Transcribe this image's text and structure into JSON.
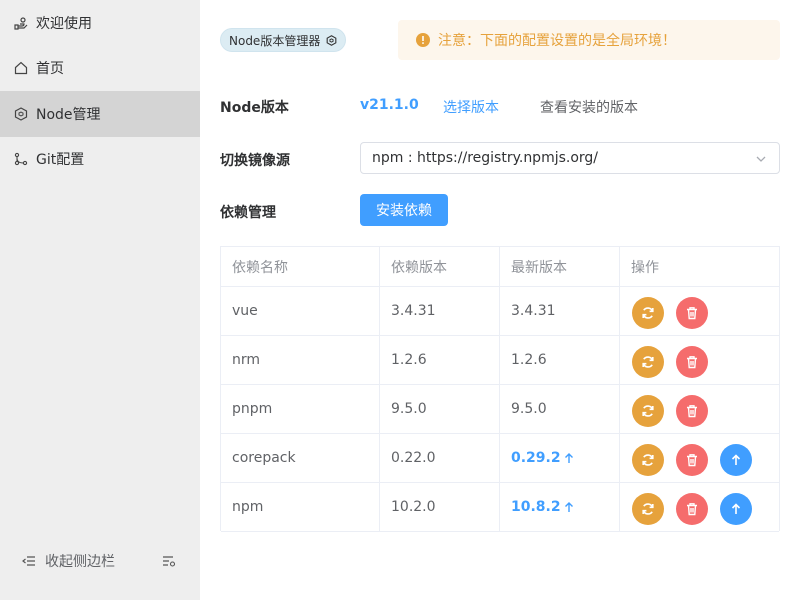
{
  "sidebar": {
    "items": [
      {
        "label": "欢迎使用",
        "icon": "hand-icon",
        "active": false
      },
      {
        "label": "首页",
        "icon": "home-icon",
        "active": false
      },
      {
        "label": "Node管理",
        "icon": "node-icon",
        "active": true
      },
      {
        "label": "Git配置",
        "icon": "git-branch-icon",
        "active": false
      }
    ],
    "collapse_label": "收起侧边栏"
  },
  "header": {
    "tag_label": "Node版本管理器",
    "notice": "注意：下面的配置设置的是全局环境！"
  },
  "node": {
    "version_label": "Node版本",
    "version": "v21.1.0",
    "select_link": "选择版本",
    "installed_link": "查看安装的版本"
  },
  "mirror": {
    "label": "切换镜像源",
    "value": "npm : https://registry.npmjs.org/"
  },
  "deps": {
    "label": "依赖管理",
    "install_button": "安装依赖"
  },
  "table": {
    "headers": [
      "依赖名称",
      "依赖版本",
      "最新版本",
      "操作"
    ],
    "rows": [
      {
        "name": "vue",
        "version": "3.4.31",
        "latest": "3.4.31",
        "upgradable": false
      },
      {
        "name": "nrm",
        "version": "1.2.6",
        "latest": "1.2.6",
        "upgradable": false
      },
      {
        "name": "pnpm",
        "version": "9.5.0",
        "latest": "9.5.0",
        "upgradable": false
      },
      {
        "name": "corepack",
        "version": "0.22.0",
        "latest": "0.29.2",
        "upgradable": true
      },
      {
        "name": "npm",
        "version": "10.2.0",
        "latest": "10.8.2",
        "upgradable": true
      }
    ]
  },
  "colors": {
    "primary": "#409eff",
    "warning": "#e6a23c",
    "danger": "#f56c6c",
    "sidebar_bg": "#eeeeee",
    "sidebar_active": "#d4d4d4"
  }
}
